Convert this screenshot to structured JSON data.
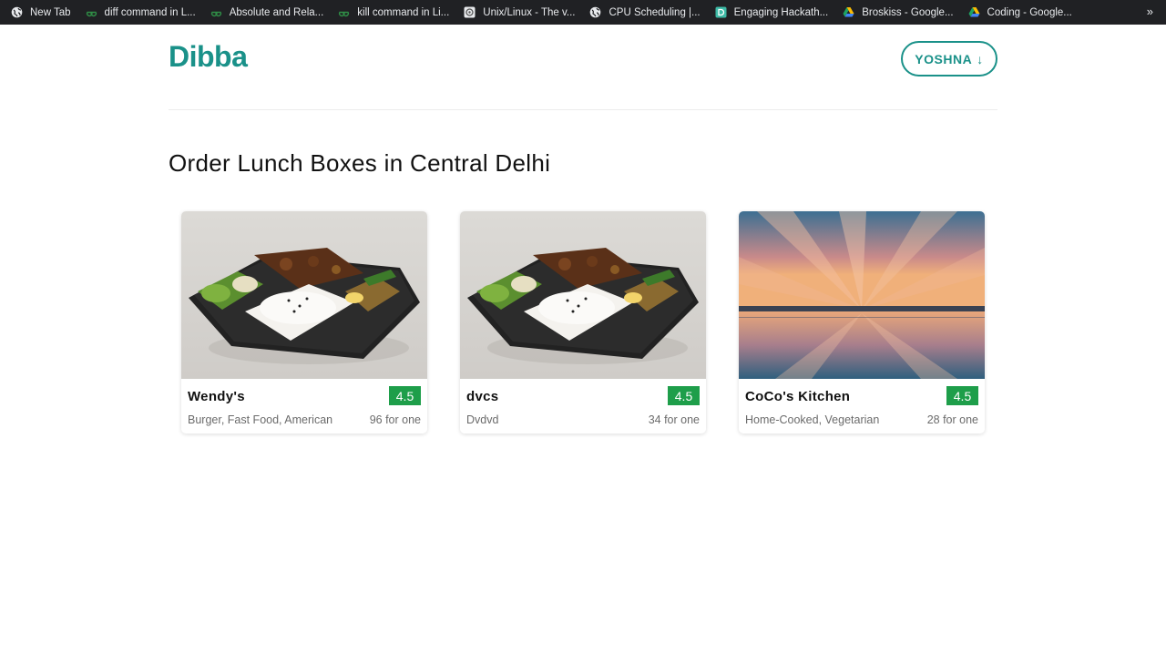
{
  "bookmarks": [
    {
      "label": "New Tab",
      "icon": "globe-icon"
    },
    {
      "label": "diff command in L...",
      "icon": "gfg-icon"
    },
    {
      "label": "Absolute and Rela...",
      "icon": "gfg-icon"
    },
    {
      "label": "kill command in Li...",
      "icon": "gfg-icon"
    },
    {
      "label": "Unix/Linux - The v...",
      "icon": "tutorialspoint-icon"
    },
    {
      "label": "CPU Scheduling |...",
      "icon": "globe-icon"
    },
    {
      "label": "Engaging Hackath...",
      "icon": "devfolio-icon"
    },
    {
      "label": "Broskiss - Google...",
      "icon": "drive-icon"
    },
    {
      "label": "Coding - Google...",
      "icon": "drive-icon"
    }
  ],
  "bookmarks_more": "»",
  "header": {
    "logo": "Dibba",
    "user_button": "YOSHNA",
    "user_button_icon": "arrow-down-icon",
    "user_arrow": "↓"
  },
  "page_title": "Order Lunch Boxes in Central Delhi",
  "colors": {
    "brand": "#1a9189",
    "rating_bg": "#1e9e4a",
    "bookmark_bar": "#202124"
  },
  "restaurants": [
    {
      "name": "Wendy's",
      "rating": "4.5",
      "cuisines": "Burger, Fast Food, American",
      "price": "96 for one",
      "image": "bento-lunchbox-photo"
    },
    {
      "name": "dvcs",
      "rating": "4.5",
      "cuisines": "Dvdvd",
      "price": "34 for one",
      "image": "bento-lunchbox-photo"
    },
    {
      "name": "CoCo's Kitchen",
      "rating": "4.5",
      "cuisines": "Home-Cooked, Vegetarian",
      "price": "28 for one",
      "image": "sunset-sea-photo"
    }
  ]
}
